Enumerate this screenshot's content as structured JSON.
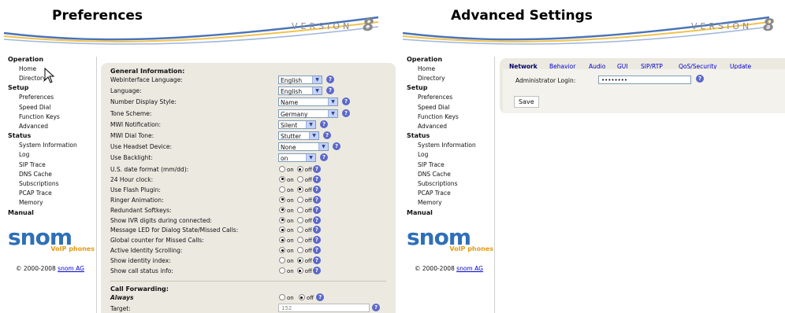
{
  "left": {
    "title": "Preferences",
    "version_word": "VERSION",
    "version_num": "8",
    "sidebar": {
      "operation": "Operation",
      "operation_items": [
        "Home",
        "Directory"
      ],
      "setup": "Setup",
      "setup_items": [
        "Preferences",
        "Speed Dial",
        "Function Keys",
        "Advanced"
      ],
      "status": "Status",
      "status_items": [
        "System Information",
        "Log",
        "SIP Trace",
        "DNS Cache",
        "Subscriptions",
        "PCAP Trace",
        "Memory"
      ],
      "manual": "Manual"
    },
    "logo": {
      "brand": "snom",
      "sub": "VoIP phones"
    },
    "copyright": {
      "text": "© 2000-2008",
      "link": "snom AG"
    },
    "general_heading": "General Information:",
    "selects": [
      {
        "label": "Webinterface Language:",
        "value": "English"
      },
      {
        "label": "Language:",
        "value": "English"
      },
      {
        "label": "Number Display Style:",
        "value": "Name"
      },
      {
        "label": "Tone Scheme:",
        "value": "Germany"
      },
      {
        "label": "MWI Notification:",
        "value": "Silent"
      },
      {
        "label": "MWI Dial Tone:",
        "value": "Stutter"
      },
      {
        "label": "Use Headset Device:",
        "value": "None"
      },
      {
        "label": "Use Backlight:",
        "value": "on"
      }
    ],
    "radio_on": "on",
    "radio_off": "off",
    "radios": [
      {
        "label": "U.S. date format (mm/dd):",
        "checked": "off"
      },
      {
        "label": "24 Hour clock:",
        "checked": "on"
      },
      {
        "label": "Use Flash Plugin:",
        "checked": "off"
      },
      {
        "label": "Ringer Animation:",
        "checked": "on"
      },
      {
        "label": "Redundant Softkeys:",
        "checked": "on"
      },
      {
        "label": "Show IVR digits during connected:",
        "checked": "on"
      },
      {
        "label": "Message LED for Dialog State/Missed Calls:",
        "checked": "on"
      },
      {
        "label": "Global counter for Missed Calls:",
        "checked": "on"
      },
      {
        "label": "Active Identity Scrolling:",
        "checked": "on"
      },
      {
        "label": "Show identity index:",
        "checked": "off"
      },
      {
        "label": "Show call status info:",
        "checked": "off"
      }
    ],
    "call_forwarding": {
      "heading": "Call Forwarding:",
      "always": "Always",
      "always_checked": "off",
      "target_label": "Target:",
      "target_value": "152"
    }
  },
  "right": {
    "title": "Advanced Settings",
    "version_word": "VERSION",
    "version_num": "8",
    "tabs": [
      "Network",
      "Behavior",
      "Audio",
      "GUI",
      "SIP/RTP",
      "QoS/Security",
      "Update"
    ],
    "active_tab": "Network",
    "admin_label": "Administrator Login:",
    "admin_value": "••••••••",
    "save_label": "Save"
  },
  "colors": {
    "brand_blue": "#2f6fb7",
    "brand_orange": "#e39a15",
    "content_bg": "#ece9e1",
    "help_icon": "#5b67c9"
  }
}
